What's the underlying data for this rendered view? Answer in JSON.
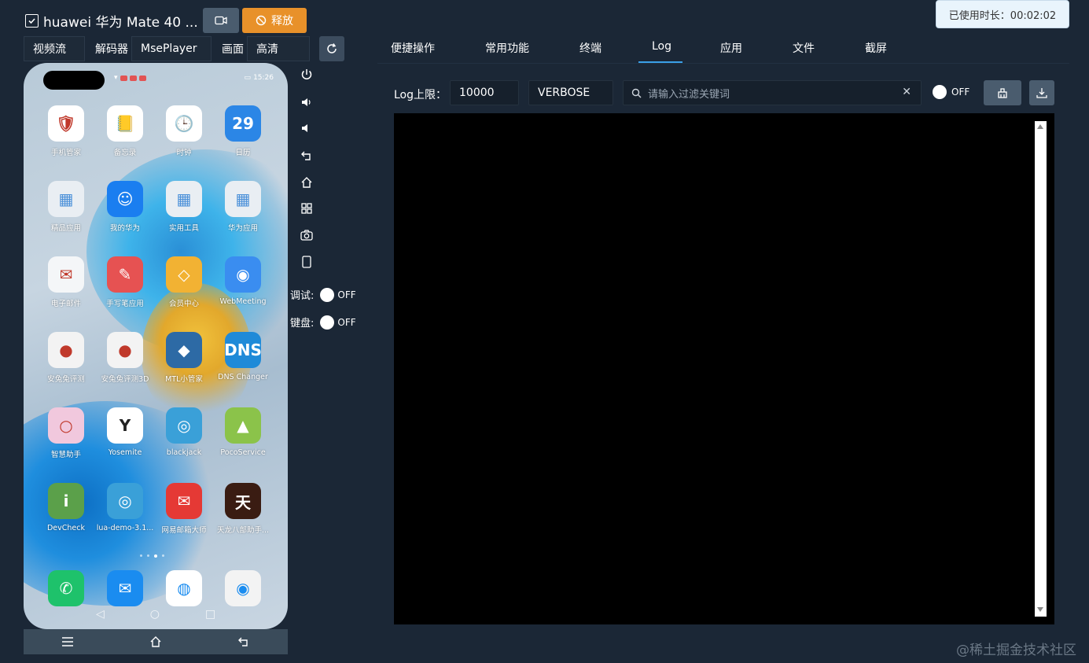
{
  "header": {
    "device_title": "huawei 华为 Mate 40 ...",
    "release_label": "释放",
    "timer_text": "已使用时长：00:02:02"
  },
  "config": {
    "stream_label": "视频流",
    "decoder_label": "解码器",
    "decoder_value": "MsePlayer",
    "quality_label": "画面",
    "quality_value": "高清"
  },
  "phone": {
    "status_time": "15:26",
    "apps": [
      {
        "label": "手机管家",
        "color": "#ffffff",
        "glyph": "🛡"
      },
      {
        "label": "备忘录",
        "color": "#ffffff",
        "glyph": "📒"
      },
      {
        "label": "时钟",
        "color": "#ffffff",
        "glyph": "🕒"
      },
      {
        "label": "日历",
        "color": "#2b86e6",
        "glyph": "29"
      },
      {
        "label": "精品应用",
        "color": "#e9eef3",
        "glyph": "▦"
      },
      {
        "label": "我的华为",
        "color": "#1a7ef0",
        "glyph": "☺"
      },
      {
        "label": "实用工具",
        "color": "#e9eef3",
        "glyph": "▦"
      },
      {
        "label": "华为应用",
        "color": "#e9eef3",
        "glyph": "▦"
      },
      {
        "label": "电子邮件",
        "color": "#f4f6f8",
        "glyph": "✉"
      },
      {
        "label": "手写笔应用",
        "color": "#e65252",
        "glyph": "✎"
      },
      {
        "label": "会员中心",
        "color": "#f2b233",
        "glyph": "◇"
      },
      {
        "label": "WebMeeting",
        "color": "#3a8df0",
        "glyph": "◉"
      },
      {
        "label": "安兔兔评测",
        "color": "#f3f3f3",
        "glyph": "●"
      },
      {
        "label": "安兔兔评测3D",
        "color": "#f3f3f3",
        "glyph": "●"
      },
      {
        "label": "MTL小管家",
        "color": "#2d6aa5",
        "glyph": "◆"
      },
      {
        "label": "DNS Changer",
        "color": "#1f8ad8",
        "glyph": "DNS"
      },
      {
        "label": "智慧助手",
        "color": "#f1c8dd",
        "glyph": "○"
      },
      {
        "label": "Yosemite",
        "color": "#ffffff",
        "glyph": "Y"
      },
      {
        "label": "blackjack",
        "color": "#3aa0d8",
        "glyph": "◎"
      },
      {
        "label": "PocoService",
        "color": "#8bc34a",
        "glyph": "▲"
      },
      {
        "label": "DevCheck",
        "color": "#5ba04a",
        "glyph": "i"
      },
      {
        "label": "lua-demo-3.1...",
        "color": "#3aa0d8",
        "glyph": "◎"
      },
      {
        "label": "网易邮箱大师",
        "color": "#e53935",
        "glyph": "✉"
      },
      {
        "label": "天龙八部助手...",
        "color": "#3a1c12",
        "glyph": "天"
      }
    ],
    "dock": [
      {
        "color": "#1ec26b",
        "glyph": "✆"
      },
      {
        "color": "#1a8cf0",
        "glyph": "✉"
      },
      {
        "color": "#ffffff",
        "glyph": "◍"
      },
      {
        "color": "#f3f3f3",
        "glyph": "◉"
      }
    ]
  },
  "controls": {
    "debug_label": "调试:",
    "debug_state": "OFF",
    "keyboard_label": "键盘:",
    "keyboard_state": "OFF"
  },
  "tabs": [
    {
      "label": "便捷操作"
    },
    {
      "label": "常用功能"
    },
    {
      "label": "终端"
    },
    {
      "label": "Log"
    },
    {
      "label": "应用"
    },
    {
      "label": "文件"
    },
    {
      "label": "截屏"
    }
  ],
  "log": {
    "limit_label": "Log上限：",
    "limit_value": "10000",
    "level_value": "VERBOSE",
    "search_placeholder": "请输入过滤关键词",
    "switch_state": "OFF"
  },
  "watermark": "@稀土掘金技术社区",
  "colors": {
    "background": "#1b2736",
    "accent": "#3aa0e8",
    "release": "#e8912a"
  }
}
